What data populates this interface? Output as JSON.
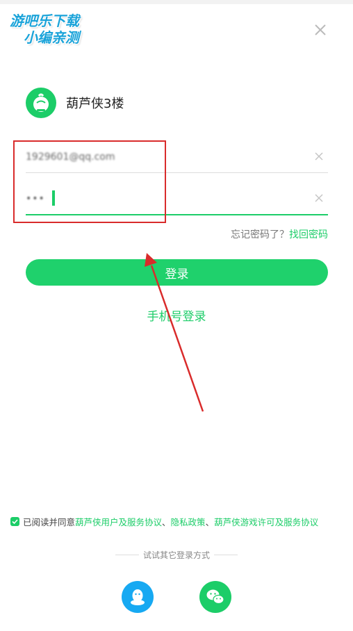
{
  "watermark": {
    "line1": "游吧乐下载",
    "line2": "小编亲测"
  },
  "app": {
    "name": "葫芦侠3楼"
  },
  "form": {
    "account_value": "1929601@qq.com",
    "password_value": "••••",
    "forgot_text": "忘记密码了？",
    "forgot_link": "找回密码",
    "login_button": "登录",
    "phone_login": "手机号登录"
  },
  "agreement": {
    "prefix": "已阅读并同意",
    "link1": "葫芦侠用户及服务协议",
    "sep1": "、",
    "link2": "隐私政策",
    "sep2": "、",
    "link3": "葫芦侠游戏许可及服务协议"
  },
  "other_login": {
    "label": "试试其它登录方式"
  },
  "colors": {
    "accent": "#1ccd68",
    "annotation": "#d92b2b",
    "qq": "#17a9f2"
  }
}
